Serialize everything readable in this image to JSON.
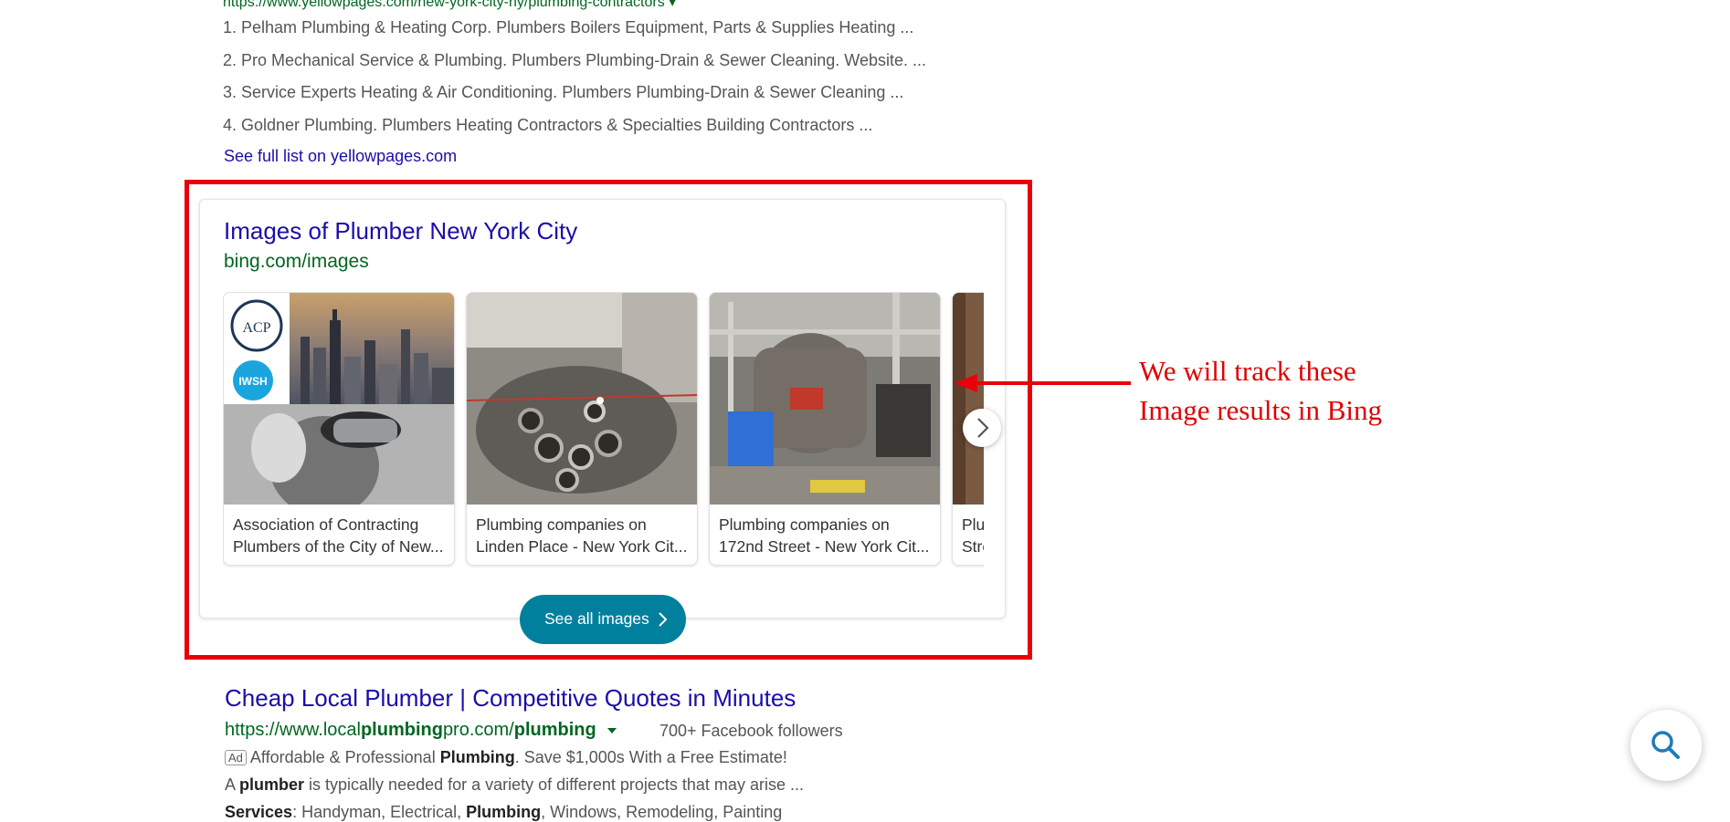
{
  "top_url": "https://www.yellowpages.com/new-york-city-ny/plumbing-contractors ▾",
  "list_items": [
    "1. Pelham Plumbing & Heating Corp. Plumbers Boilers Equipment, Parts & Supplies Heating ...",
    "2. Pro Mechanical Service & Plumbing. Plumbers Plumbing-Drain & Sewer Cleaning. Website. ...",
    "3. Service Experts Heating & Air Conditioning. Plumbers Plumbing-Drain & Sewer Cleaning ...",
    "4. Goldner Plumbing. Plumbers Heating Contractors & Specialties Building Contractors ..."
  ],
  "full_list_link": "See full list on yellowpages.com",
  "image_card": {
    "title": "Images of Plumber New York City",
    "url": "bing.com/images",
    "tiles": [
      {
        "cap1": "Association of Contracting",
        "cap2": "Plumbers of the City of New..."
      },
      {
        "cap1": "Plumbing companies on",
        "cap2": "Linden Place - New York Cit..."
      },
      {
        "cap1": "Plumbing companies on",
        "cap2": "172nd Street - New York Cit..."
      },
      {
        "cap1": "Plu",
        "cap2": "Stre"
      }
    ],
    "logo_text_acp": "ACP",
    "logo_text_iwsh": "IWSH",
    "see_all_label": "See all images"
  },
  "annotation": {
    "line1": "We will track these",
    "line2": "Image results in Bing"
  },
  "ad": {
    "title": "Cheap Local Plumber | Competitive Quotes in Minutes",
    "url_pre": "https://www.local",
    "url_b1": "plumbing",
    "url_mid": "pro.com/",
    "url_b2": "plumbing",
    "followers": "700+ Facebook followers",
    "badge": "Ad",
    "line1_pre": "Affordable & Professional ",
    "line1_bold": "Plumbing",
    "line1_post": ". Save $1,000s With a Free Estimate!",
    "line2_pre": "A ",
    "line2_bold": "plumber",
    "line2_post": " is typically needed for a variety of different projects that may arise ...",
    "line3_bold1": "Services",
    "line3_mid": ": Handyman, Electrical, ",
    "line3_bold2": "Plumbing",
    "line3_post": ", Windows, Remodeling, Painting"
  },
  "colors": {
    "link_blue": "#1a0dab",
    "url_green": "#006621",
    "highlight_red": "#e8000a",
    "button_teal": "#00809d"
  }
}
